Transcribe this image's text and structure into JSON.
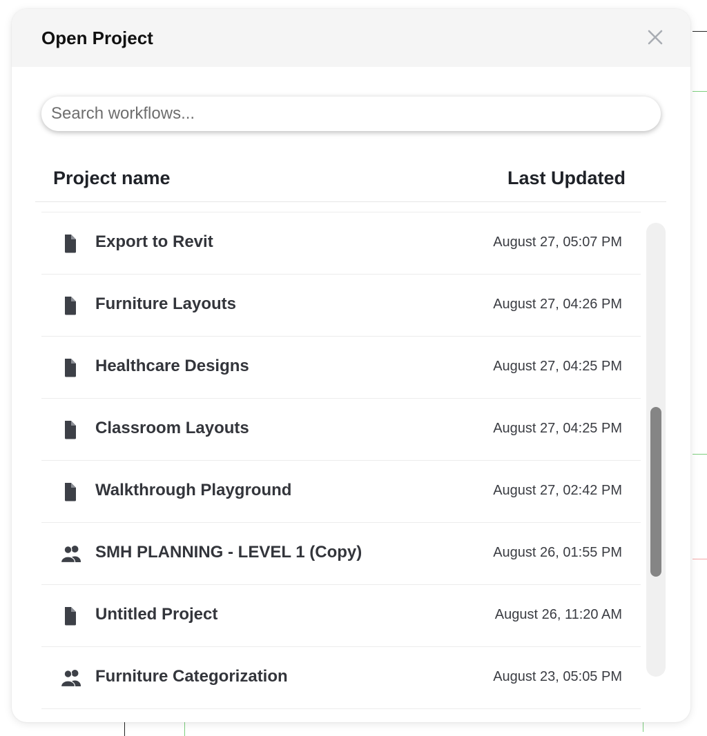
{
  "modal": {
    "title": "Open Project",
    "close_icon": "close-icon"
  },
  "search": {
    "placeholder": "Search workflows...",
    "value": ""
  },
  "table": {
    "columns": [
      "Project name",
      "Last Updated"
    ],
    "rows": [
      {
        "name": "Export to Revit",
        "updated": "August 27, 05:07 PM",
        "icon": "file-icon"
      },
      {
        "name": "Furniture Layouts",
        "updated": "August 27, 04:26 PM",
        "icon": "file-icon"
      },
      {
        "name": "Healthcare Designs",
        "updated": "August 27, 04:25 PM",
        "icon": "file-icon"
      },
      {
        "name": "Classroom Layouts",
        "updated": "August 27, 04:25 PM",
        "icon": "file-icon"
      },
      {
        "name": "Walkthrough Playground",
        "updated": "August 27, 02:42 PM",
        "icon": "file-icon"
      },
      {
        "name": "SMH PLANNING - LEVEL 1 (Copy)",
        "updated": "August 26, 01:55 PM",
        "icon": "users-icon"
      },
      {
        "name": "Untitled Project",
        "updated": "August 26, 11:20 AM",
        "icon": "file-icon"
      },
      {
        "name": "Furniture Categorization",
        "updated": "August 23, 05:05 PM",
        "icon": "users-icon"
      }
    ]
  },
  "colors": {
    "header_bg": "#f5f5f5",
    "text_primary": "#33353b",
    "scroll_thumb": "#858585"
  }
}
